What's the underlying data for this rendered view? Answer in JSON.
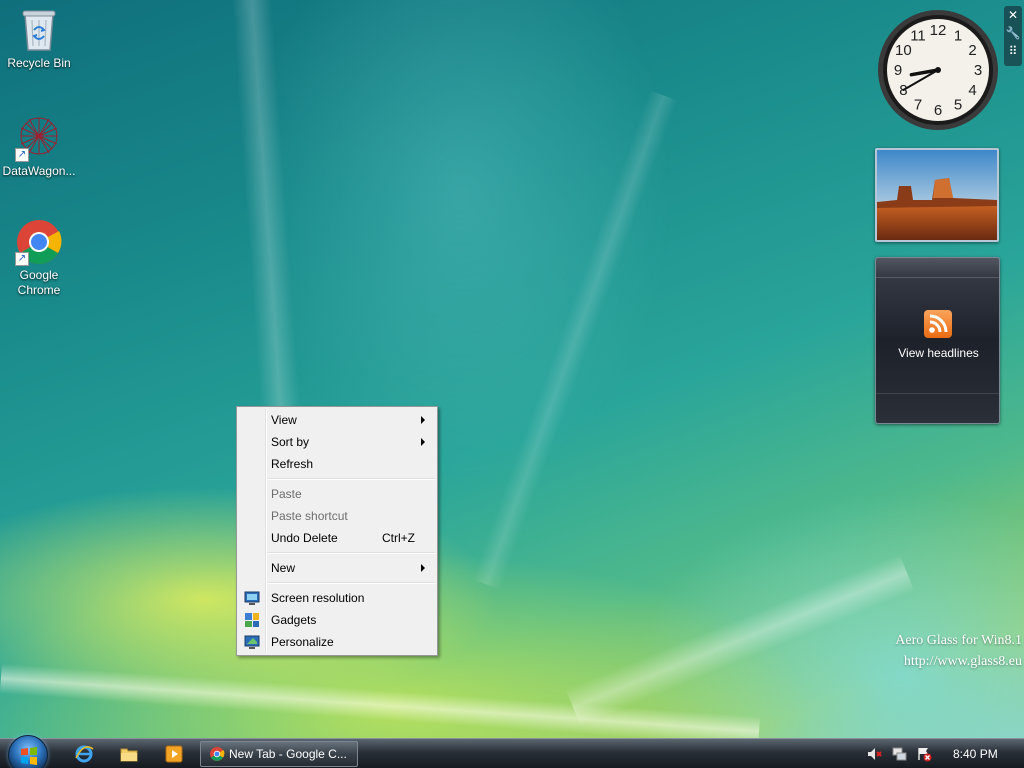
{
  "desktop": {
    "icons": [
      {
        "label": "Recycle Bin",
        "icon": "recycle-bin-icon"
      },
      {
        "label": "DataWagon...",
        "icon": "datawagon-icon"
      },
      {
        "label": "Google Chrome",
        "icon": "chrome-icon"
      }
    ],
    "watermark": {
      "line1": "Aero Glass for Win8.1",
      "line2": "http://www.glass8.eu"
    }
  },
  "gadgets": {
    "clock": {
      "time": "8:40",
      "numerals": [
        "12",
        "1",
        "2",
        "3",
        "4",
        "5",
        "6",
        "7",
        "8",
        "9",
        "10",
        "11"
      ]
    },
    "controls": [
      "close-icon",
      "wrench-icon",
      "grip-icon"
    ],
    "photo": {
      "subject": "desert-landscape"
    },
    "feed": {
      "label": "View headlines",
      "icon": "rss-icon"
    }
  },
  "context_menu": {
    "items": [
      {
        "label": "View",
        "submenu": true,
        "disabled": false
      },
      {
        "label": "Sort by",
        "submenu": true,
        "disabled": false
      },
      {
        "label": "Refresh",
        "submenu": false,
        "disabled": false
      },
      {
        "label": "Paste",
        "submenu": false,
        "disabled": true
      },
      {
        "label": "Paste shortcut",
        "submenu": false,
        "disabled": true
      },
      {
        "label": "Undo Delete",
        "shortcut": "Ctrl+Z",
        "submenu": false,
        "disabled": false
      },
      {
        "label": "New",
        "submenu": true,
        "disabled": false
      },
      {
        "label": "Screen resolution",
        "icon": "monitor-icon",
        "disabled": false
      },
      {
        "label": "Gadgets",
        "icon": "gadgets-icon",
        "disabled": false
      },
      {
        "label": "Personalize",
        "icon": "personalize-icon",
        "disabled": false
      }
    ]
  },
  "taskbar": {
    "quick_launch": [
      "internet-explorer-icon",
      "file-explorer-icon",
      "media-player-icon"
    ],
    "tasks": [
      {
        "label": "New Tab - Google C...",
        "icon": "chrome-icon"
      }
    ],
    "tray_icons": [
      "volume-muted-icon",
      "network-icon",
      "action-center-icon"
    ],
    "clock": "8:40 PM"
  }
}
